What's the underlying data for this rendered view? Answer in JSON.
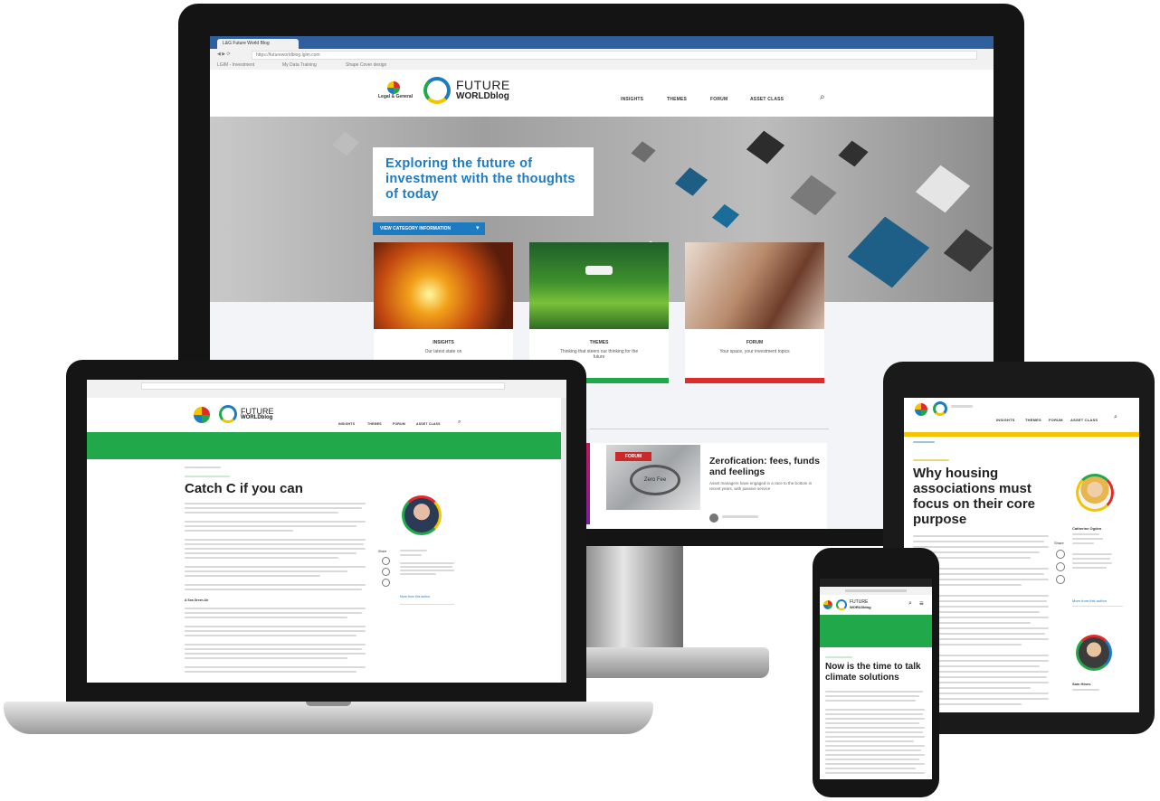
{
  "monitor": {
    "tab_title": "L&G Future World Blog",
    "url": "https://futureworldblog.lgim.com",
    "bookmarks": [
      "LGIM - Investment",
      "My Data Training",
      "Shape Cover design"
    ],
    "logo_lg": "Legal & General",
    "logo_future": "FUTURE",
    "logo_world": "WORLDblog",
    "nav": [
      "INSIGHTS",
      "THEMES",
      "FORUM",
      "ASSET CLASS"
    ],
    "hero_text": "Exploring the future of investment with the thoughts of today",
    "hero_button": "VIEW CATEGORY INFORMATION",
    "cards": [
      {
        "title": "INSIGHTS",
        "text": "Our latest state on",
        "bar_color": "#1d7bc2"
      },
      {
        "title": "THEMES",
        "text": "Thinking that steers our thinking for the future",
        "bar_color": "#21a84a"
      },
      {
        "title": "FORUM",
        "text": "Your space, your investment topics",
        "bar_color": "#e02b2b"
      }
    ],
    "article_badge": "FORUM",
    "article_title": "Zerofication: fees, funds and feelings",
    "article_excerpt": "Asset managers have engaged in a race to the bottom in recent years, with passive service",
    "calculator_label": "Zero Fee"
  },
  "laptop": {
    "logo_future": "FUTURE",
    "logo_world": "WORLDblog",
    "nav": [
      "INSIGHTS",
      "THEMES",
      "FORUM",
      "ASSET CLASS"
    ],
    "article_title": "Catch C if you can",
    "share_label": "Share",
    "more_link": "More from this author",
    "section_heading": "A Sea Green Air"
  },
  "tablet": {
    "nav": [
      "INSIGHTS",
      "THEMES",
      "FORUM",
      "ASSET CLASS"
    ],
    "article_title": "Why housing associations must focus on their core purpose",
    "share_label": "Share",
    "author_name": "Catherine Ogden",
    "more_link": "More from this author",
    "second_author": "Sam Hines"
  },
  "phone": {
    "logo_future": "FUTURE",
    "logo_world": "WORLDblog",
    "article_title": "Now is the time to talk climate solutions"
  },
  "colors": {
    "blue": "#1d7bc2",
    "green": "#21a84a",
    "red": "#e02b2b",
    "yellow": "#f5c400"
  }
}
